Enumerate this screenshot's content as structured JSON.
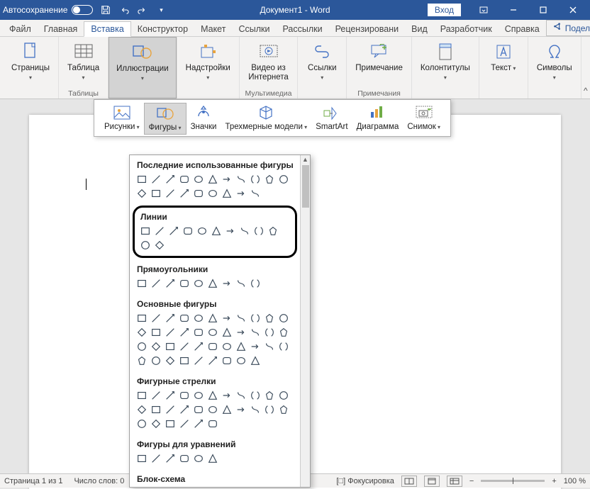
{
  "titlebar": {
    "autosave_label": "Автосохранение",
    "title": "Документ1 - Word",
    "login": "Вход"
  },
  "tabs": {
    "file": "Файл",
    "home": "Главная",
    "insert": "Вставка",
    "design": "Конструктор",
    "layout": "Макет",
    "references": "Ссылки",
    "mailings": "Рассылки",
    "review": "Рецензировани",
    "view": "Вид",
    "developer": "Разработчик",
    "help": "Справка",
    "share": "Поделиться"
  },
  "ribbon": {
    "pages": "Страницы",
    "table": "Таблица",
    "tables_group": "Таблицы",
    "illustrations": "Иллюстрации",
    "addins": "Надстройки",
    "online_video": "Видео из Интернета",
    "media_group": "Мультимедиа",
    "links": "Ссылки",
    "comment": "Примечание",
    "comments_group": "Примечания",
    "headerfooter": "Колонтитулы",
    "text": "Текст",
    "symbols": "Символы"
  },
  "sub": {
    "pictures": "Рисунки",
    "shapes": "Фигуры",
    "icons": "Значки",
    "models3d": "Трехмерные модели",
    "smartart": "SmartArt",
    "chart": "Диаграмма",
    "screenshot": "Снимок"
  },
  "gallery": {
    "recent": "Последние использованные фигуры",
    "lines": "Линии",
    "rectangles": "Прямоугольники",
    "basic": "Основные фигуры",
    "arrows": "Фигурные стрелки",
    "equation": "Фигуры для уравнений",
    "flowchart": "Блок-схема"
  },
  "status": {
    "page": "Страница 1 из 1",
    "words": "Число слов: 0",
    "focus": "Фокусировка",
    "zoom": "100 %"
  }
}
